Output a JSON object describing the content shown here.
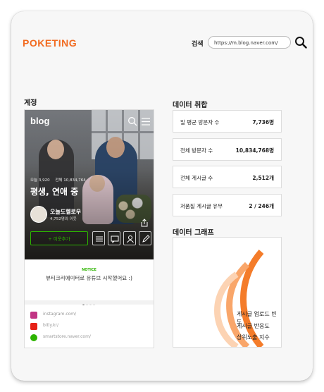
{
  "header": {
    "logo": "POKETING",
    "search_label": "검색",
    "search_value": "https://m.blog.naver.com/"
  },
  "account": {
    "section_title": "계정",
    "blog_logo": "blog",
    "today_label": "오늘 3,920",
    "total_label": "전체 10,834,764",
    "blog_title": "평생, 연애 중",
    "nickname": "오늘도헬로우",
    "neighbors": "4,752명의 이웃",
    "neighbor_button": "+ 이웃추가",
    "notice_label": "NOTICE",
    "notice_text": "뷰티크리에이터로 유튜브 시작했어요 :)",
    "links": [
      {
        "icon": "instagram-icon",
        "text": "instagram.com/",
        "color": "#c13584"
      },
      {
        "icon": "youtube-icon",
        "text": "bitly.kr/",
        "color": "#e62117"
      },
      {
        "icon": "smartstore-icon",
        "text": "smartstore.naver.com/",
        "color": "#2db400"
      }
    ]
  },
  "data_info": {
    "section_title": "데이터 취합",
    "items": [
      {
        "label": "일 평균 방문자 수",
        "value": "7,736명"
      },
      {
        "label": "전체 방문자 수",
        "value": "10,834,768명"
      },
      {
        "label": "전체 게시글 수",
        "value": "2,512개"
      },
      {
        "label": "저품질 게시글 유무",
        "value": "2 / 246개"
      }
    ]
  },
  "data_graph": {
    "section_title": "데이터 그래프",
    "legend": [
      "게시글 업로드 빈도",
      "게시글 반응도",
      "상위노출 지수"
    ],
    "colors": {
      "accent": "#f26b21",
      "orange_dark": "#f47c2a",
      "orange_mid": "#f9a66a",
      "orange_light": "#fcd3b3"
    }
  }
}
